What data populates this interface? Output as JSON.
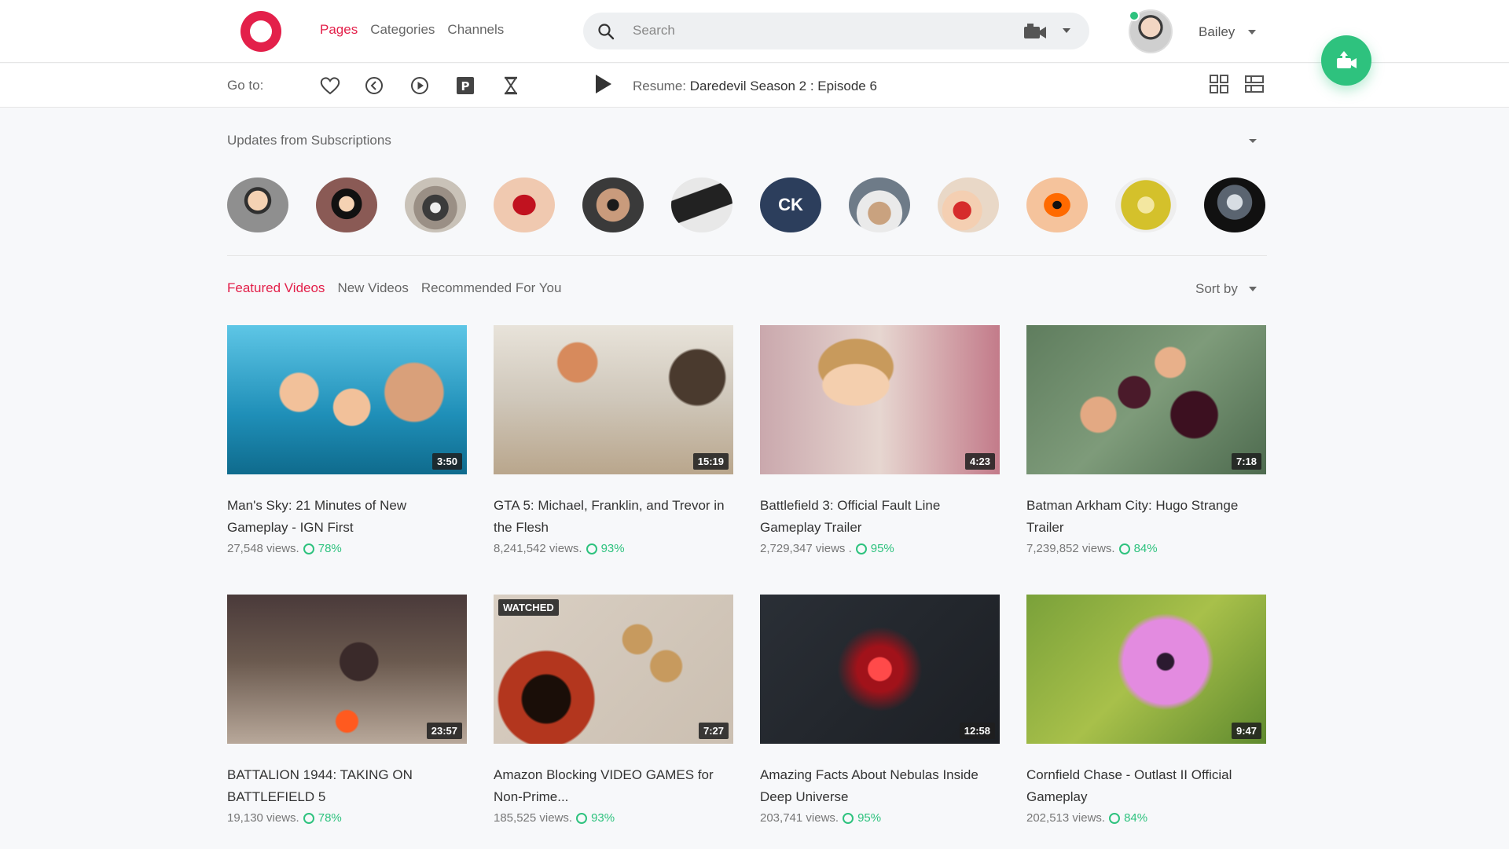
{
  "header": {
    "nav": [
      "Pages",
      "Categories",
      "Channels"
    ],
    "active_nav": 0,
    "search_placeholder": "Search",
    "user_name": "Bailey"
  },
  "subbar": {
    "goto_label": "Go to:",
    "resume_label": "Resume:",
    "resume_title": "Daredevil Season 2 : Episode 6"
  },
  "subscriptions": {
    "title": "Updates from Subscriptions",
    "ck_initials": "CK"
  },
  "tabs": {
    "items": [
      "Featured Videos",
      "New Videos",
      "Recommended For You"
    ],
    "active": 0,
    "sort_label": "Sort by"
  },
  "videos": [
    {
      "title": "Man's Sky: 21 Minutes of New Gameplay - IGN First",
      "views": "27,548 views.",
      "rating": "78%",
      "duration": "3:50",
      "watched": ""
    },
    {
      "title": "GTA 5: Michael, Franklin, and Trevor in the Flesh",
      "views": "8,241,542 views.",
      "rating": "93%",
      "duration": "15:19",
      "watched": ""
    },
    {
      "title": "Battlefield 3: Official Fault Line Gameplay Trailer",
      "views": "2,729,347 views .",
      "rating": "95%",
      "duration": "4:23",
      "watched": ""
    },
    {
      "title": "Batman Arkham City: Hugo Strange Trailer",
      "views": "7,239,852 views.",
      "rating": "84%",
      "duration": "7:18",
      "watched": ""
    },
    {
      "title": "BATTALION 1944: TAKING ON BATTLEFIELD 5",
      "views": "19,130 views.",
      "rating": "78%",
      "duration": "23:57",
      "watched": ""
    },
    {
      "title": "Amazon Blocking VIDEO GAMES for Non-Prime...",
      "views": "185,525 views.",
      "rating": "93%",
      "duration": "7:27",
      "watched": "WATCHED"
    },
    {
      "title": "Amazing Facts About Nebulas Inside Deep Universe",
      "views": "203,741 views.",
      "rating": "95%",
      "duration": "12:58",
      "watched": ""
    },
    {
      "title": "Cornfield Chase - Outlast II Official Gameplay",
      "views": "202,513 views.",
      "rating": "84%",
      "duration": "9:47",
      "watched": ""
    }
  ],
  "colors": {
    "accent": "#e3204a",
    "green": "#2ec27e",
    "ck_badge": "#2c3e5c"
  }
}
